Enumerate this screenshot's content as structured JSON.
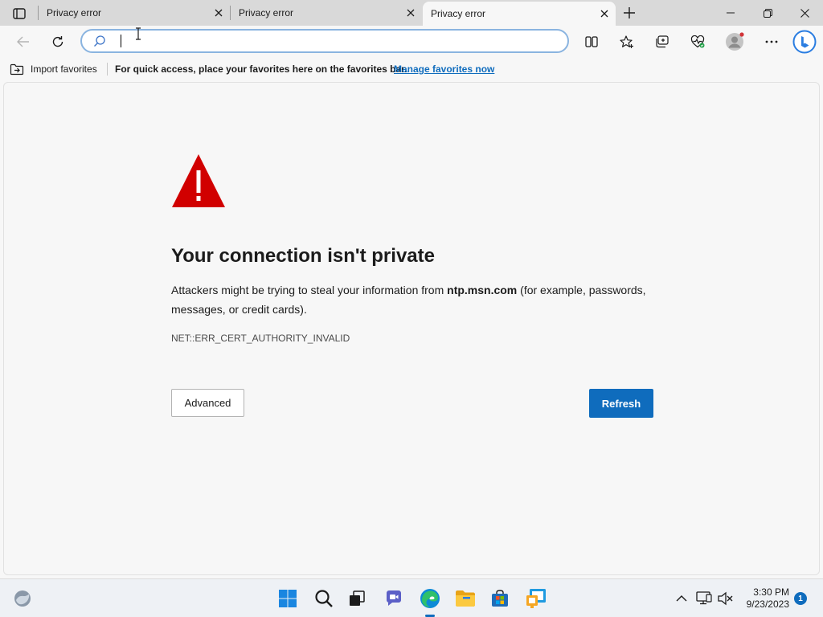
{
  "tabs": [
    {
      "title": "Privacy error",
      "active": false
    },
    {
      "title": "Privacy error",
      "active": false
    },
    {
      "title": "Privacy error",
      "active": true
    }
  ],
  "omnibox": {
    "value": "",
    "placeholder": ""
  },
  "favorites_bar": {
    "import_label": "Import favorites",
    "hint": "For quick access, place your favorites here on the favorites bar.",
    "manage_link": "Manage favorites now"
  },
  "error_page": {
    "title": "Your connection isn't private",
    "body_prefix": "Attackers might be trying to steal your information from ",
    "domain": "ntp.msn.com",
    "body_suffix": " (for example, passwords, messages, or credit cards).",
    "error_code": "NET::ERR_CERT_AUTHORITY_INVALID",
    "advanced_label": "Advanced",
    "refresh_label": "Refresh"
  },
  "taskbar": {
    "time": "3:30 PM",
    "date": "9/23/2023",
    "notification_count": "1"
  },
  "colors": {
    "accent": "#0f6cbd",
    "warning": "#d10000",
    "omnibox_border": "#8ab4e0"
  },
  "icons": {
    "toolbar": [
      "back-arrow-icon",
      "refresh-icon",
      "search-icon",
      "split-screen-icon",
      "add-favorite-icon",
      "collections-icon",
      "browser-essentials-icon",
      "profile-icon",
      "more-icon",
      "bing-chat-icon"
    ],
    "taskbar": [
      "widgets-icon",
      "start-icon",
      "search-icon",
      "task-view-icon",
      "teams-chat-icon",
      "edge-icon",
      "file-explorer-icon",
      "store-icon",
      "remote-desktop-icon",
      "show-hidden-icons-icon",
      "network-icon",
      "volume-muted-icon"
    ]
  }
}
